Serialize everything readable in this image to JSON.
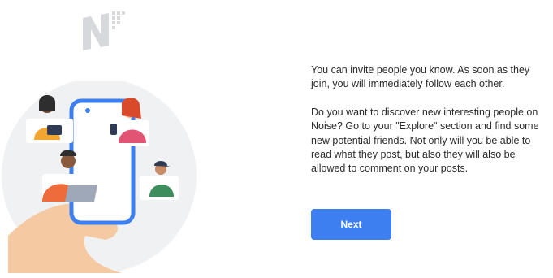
{
  "logo": {
    "icon": "noise-logo-icon"
  },
  "illustration": {
    "icon": "people-connecting-phone-illustration"
  },
  "content": {
    "paragraph_1": "You can invite people you know. As soon as they join, you will immediately follow each other.",
    "paragraph_2": "Do you want to discover new interesting people on Noise? Go to your \"Explore\" section and find some new potential friends. Not only will you be able to read what they post, but also they will also be allowed to comment on your posts."
  },
  "actions": {
    "next_label": "Next"
  },
  "colors": {
    "accent": "#3d7ff0",
    "text": "#2b2b2b",
    "circle_bg": "#f0f1f3"
  }
}
